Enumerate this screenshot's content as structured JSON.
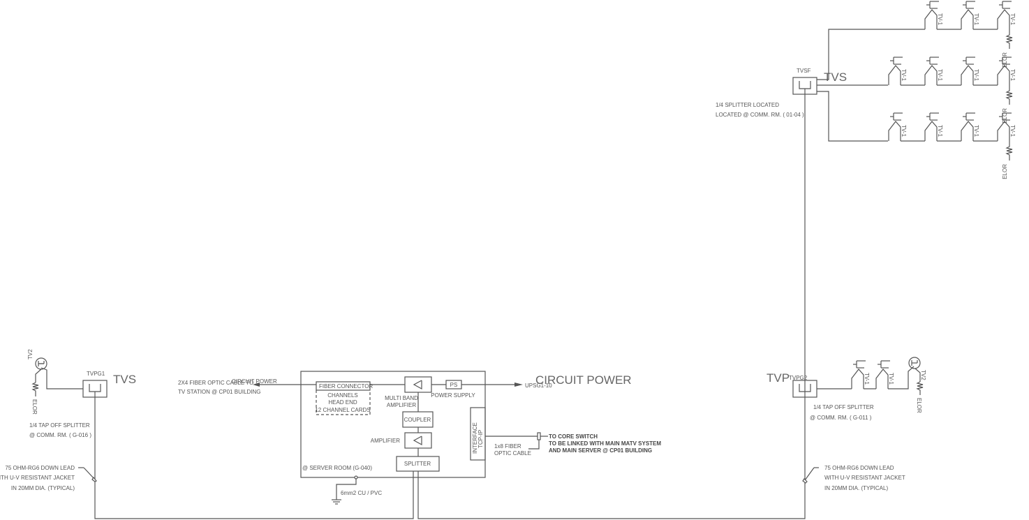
{
  "diagram": {
    "type": "MATV / TV distribution riser schematic",
    "colors": {
      "line": "#555555",
      "text": "#555555",
      "background": "#ffffff"
    }
  },
  "splitter_top": {
    "tag": "TVSF",
    "big_label": "TVS",
    "note_line1": "1/4 SPLITTER  LOCATED",
    "note_line2": "LOCATED @ COMM. RM. ( 01-04 )",
    "rows": [
      {
        "tap_label": "TV-1",
        "tap_count": 3,
        "terminator": "ELOR"
      },
      {
        "tap_label": "TV-1",
        "tap_count": 4,
        "terminator": "ELOR"
      },
      {
        "tap_label": "TV-1",
        "tap_count": 4,
        "terminator": "ELOR"
      }
    ]
  },
  "splitter_left": {
    "tag": "TVPG1",
    "big_label": "TVS",
    "outlet_label": "TV2",
    "terminator": "ELOR",
    "note_line1": "1/4 TAP OFF SPLITTER",
    "note_line2": "@ COMM. RM. ( G-016 )"
  },
  "splitter_right": {
    "tag": "TVPG2",
    "big_label": "TVP",
    "tap_label": "TV-1",
    "outlet_label": "TV2",
    "terminator": "ELOR",
    "note_line1": "1/4 TAP OFF SPLITTER",
    "note_line2": "@ COMM. RM. ( G-011 )"
  },
  "down_lead": {
    "line1": "75 OHM-RG6 DOWN LEAD",
    "line2": "WITH U-V RESISTANT JACKET",
    "line3": "IN 20MM DIA. (TYPICAL)"
  },
  "headend": {
    "fiber_in_line1": "2X4 FIBER OPTIC CABLE TO",
    "fiber_in_line2": "TV STATION @ CP01 BUILDING",
    "circuit_power_small": "CIRCUIT POWER",
    "fiber_connector": "FIBER CONNECTOR",
    "channels": "CHANNELS",
    "head_end": "HEAD END",
    "channel_cards": "12 CHANNEL CARDS",
    "multiband_line1": "MULTI BAND",
    "multiband_line2": "AMPLIFIER",
    "ps": "PS",
    "power_supply": "POWER SUPPLY",
    "coupler": "COUPLER",
    "amplifier": "AMPLIFIER",
    "splitter": "SPLITTER",
    "interface_line1": "INTERFACE",
    "interface_line2": "TCP-IP",
    "room": "@ SERVER ROOM (G-040)",
    "ground": "6mm2 CU / PVC",
    "power_feed": "UPSG1-10",
    "circuit_power_big": "CIRCUIT POWER",
    "fiber_out_line1": "1x8 FIBER",
    "fiber_out_line2": "OPTIC CABLE",
    "core_line1": "TO CORE SWITCH",
    "core_line2": "TO BE LINKED WITH MAIN MATV SYSTEM",
    "core_line3": "AND MAIN SERVER @ CP01 BUILDING"
  }
}
